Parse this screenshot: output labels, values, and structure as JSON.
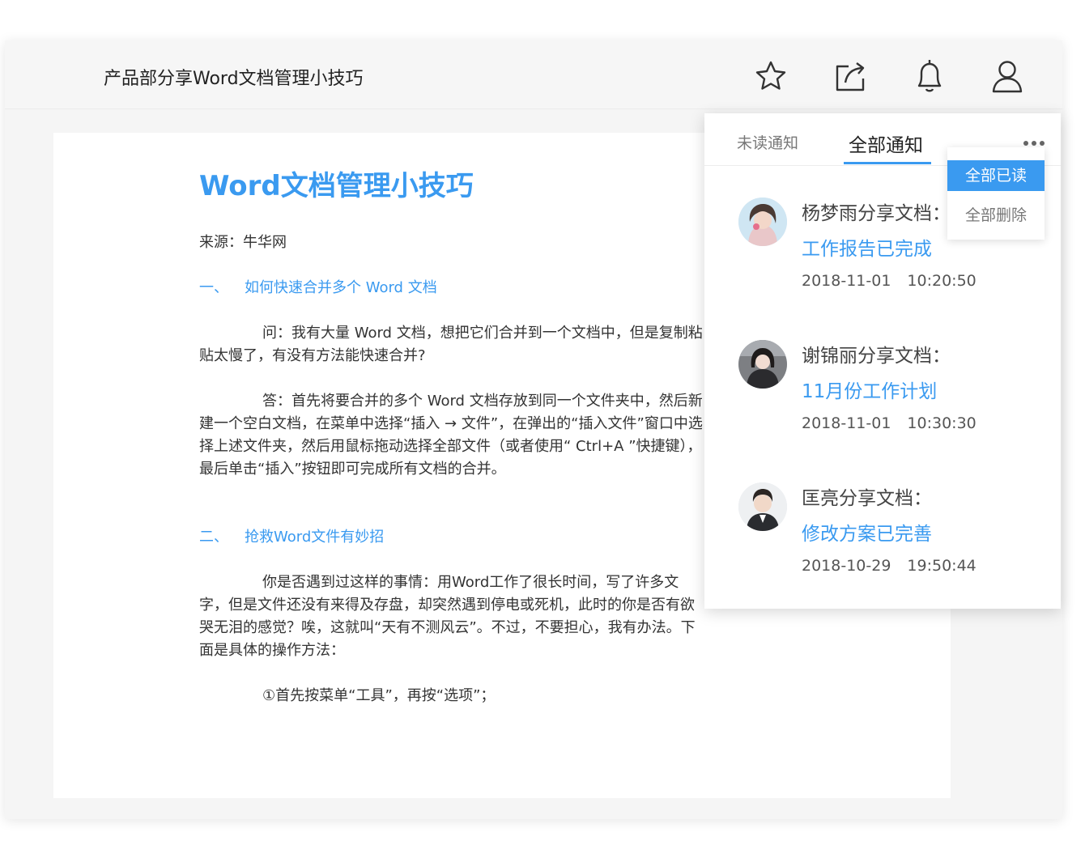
{
  "header": {
    "title": "产品部分享Word文档管理小技巧",
    "icons": [
      "star-icon",
      "share-icon",
      "bell-icon",
      "user-icon"
    ]
  },
  "document": {
    "heading": "Word文档管理小技巧",
    "source": "来源：牛华网",
    "sections": [
      {
        "num": "一、",
        "title": "如何快速合并多个 Word 文档"
      },
      {
        "num": "二、",
        "title": "抢救Word文件有妙招"
      }
    ],
    "paragraphs": [
      "问：我有大量 Word 文档，想把它们合并到一个文档中，但是复制粘贴太慢了，有没有方法能快速合并?",
      "答：首先将要合并的多个 Word 文档存放到同一个文件夹中，然后新建一个空白文档，在菜单中选择“插入 → 文件”，在弹出的“插入文件”窗口中选择上述文件夹，然后用鼠标拖动选择全部文件（或者使用“ Ctrl+A ”快捷键），最后单击“插入”按钮即可完成所有文档的合并。",
      "你是否遇到过这样的事情：用Word工作了很长时间，写了许多文字，但是文件还没有来得及存盘，却突然遇到停电或死机，此时的你是否有欲哭无泪的感觉？唉，这就叫“天有不测风云”。不过，不要担心，我有办法。下面是具体的操作方法：",
      "①首先按菜单“工具”，再按“选项”；"
    ]
  },
  "notifications": {
    "tabs": [
      "未读通知",
      "全部通知"
    ],
    "active_tab": "全部通知",
    "more_icon": "more-dots-icon",
    "menu": [
      "全部已读",
      "全部删除"
    ],
    "items": [
      {
        "title": "杨梦雨分享文档：",
        "link": "工作报告已完成",
        "date": "2018-11-01",
        "time": "10:20:50"
      },
      {
        "title": "谢锦丽分享文档：",
        "link": "11月份工作计划",
        "date": "2018-11-01",
        "time": "10:30:30"
      },
      {
        "title": "匡亮分享文档：",
        "link": "修改方案已完善",
        "date": "2018-10-29",
        "time": "19:50:44"
      }
    ]
  },
  "colors": {
    "accent": "#3a9af0",
    "text": "#333333",
    "background": "#f5f5f5"
  }
}
